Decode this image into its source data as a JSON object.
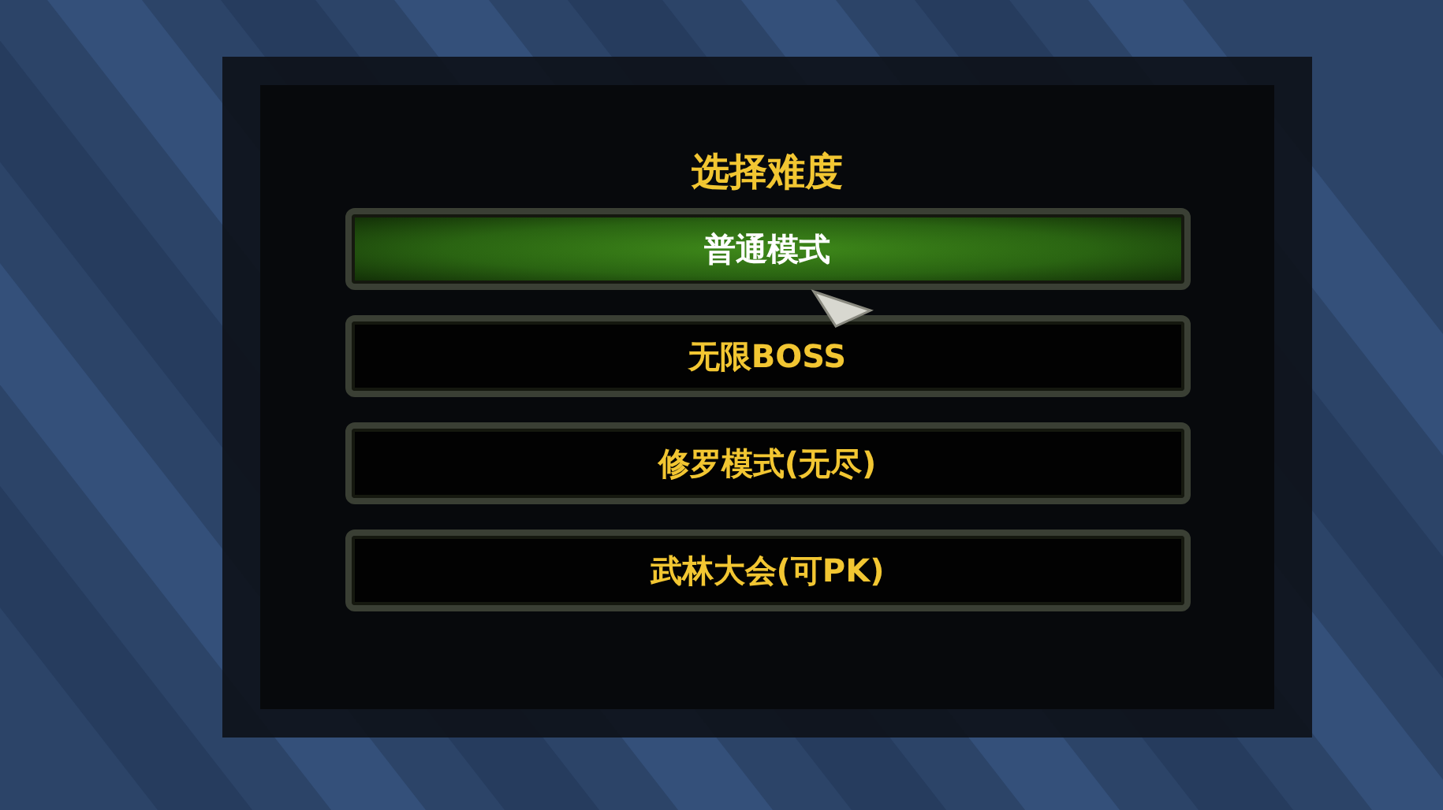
{
  "dialog": {
    "title": "选择难度",
    "options": [
      {
        "label": "普通模式",
        "selected": true
      },
      {
        "label": "无限BOSS",
        "selected": false
      },
      {
        "label": "修罗模式(无尽)",
        "selected": false
      },
      {
        "label": "武林大会(可PK)",
        "selected": false
      }
    ]
  }
}
